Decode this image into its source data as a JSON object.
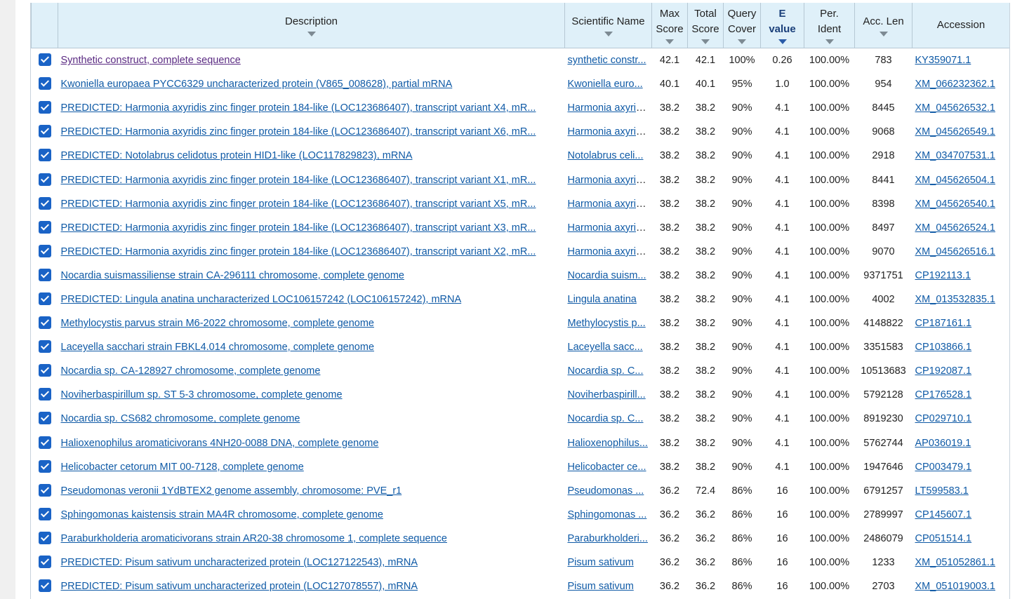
{
  "headers": {
    "description": "Description",
    "scientific_name": "Scientific Name",
    "max_score": [
      "Max",
      "Score"
    ],
    "total_score": [
      "Total",
      "Score"
    ],
    "query_cover": [
      "Query",
      "Cover"
    ],
    "e_value": [
      "E",
      "value"
    ],
    "per_ident": [
      "Per.",
      "Ident"
    ],
    "acc_len": "Acc. Len",
    "accession": "Accession"
  },
  "rows": [
    {
      "description": "Synthetic construct, complete sequence",
      "sci": "synthetic constr...",
      "max": "42.1",
      "total": "42.1",
      "cover": "100%",
      "evalue": "0.26",
      "ident": "100.00%",
      "len": "783",
      "acc": "KY359071.1"
    },
    {
      "description": "Kwoniella europaea PYCC6329 uncharacterized protein (V865_008628), partial mRNA",
      "sci": "Kwoniella euro...",
      "max": "40.1",
      "total": "40.1",
      "cover": "95%",
      "evalue": "1.0",
      "ident": "100.00%",
      "len": "954",
      "acc": "XM_066232362.1"
    },
    {
      "description": "PREDICTED: Harmonia axyridis zinc finger protein 184-like (LOC123686407), transcript variant X4, mR...",
      "sci": "Harmonia axyridis",
      "max": "38.2",
      "total": "38.2",
      "cover": "90%",
      "evalue": "4.1",
      "ident": "100.00%",
      "len": "8445",
      "acc": "XM_045626532.1"
    },
    {
      "description": "PREDICTED: Harmonia axyridis zinc finger protein 184-like (LOC123686407), transcript variant X6, mR...",
      "sci": "Harmonia axyridis",
      "max": "38.2",
      "total": "38.2",
      "cover": "90%",
      "evalue": "4.1",
      "ident": "100.00%",
      "len": "9068",
      "acc": "XM_045626549.1"
    },
    {
      "description": "PREDICTED: Notolabrus celidotus protein HID1-like (LOC117829823), mRNA",
      "sci": "Notolabrus celi...",
      "max": "38.2",
      "total": "38.2",
      "cover": "90%",
      "evalue": "4.1",
      "ident": "100.00%",
      "len": "2918",
      "acc": "XM_034707531.1"
    },
    {
      "description": "PREDICTED: Harmonia axyridis zinc finger protein 184-like (LOC123686407), transcript variant X1, mR...",
      "sci": "Harmonia axyridis",
      "max": "38.2",
      "total": "38.2",
      "cover": "90%",
      "evalue": "4.1",
      "ident": "100.00%",
      "len": "8441",
      "acc": "XM_045626504.1"
    },
    {
      "description": "PREDICTED: Harmonia axyridis zinc finger protein 184-like (LOC123686407), transcript variant X5, mR...",
      "sci": "Harmonia axyridis",
      "max": "38.2",
      "total": "38.2",
      "cover": "90%",
      "evalue": "4.1",
      "ident": "100.00%",
      "len": "8398",
      "acc": "XM_045626540.1"
    },
    {
      "description": "PREDICTED: Harmonia axyridis zinc finger protein 184-like (LOC123686407), transcript variant X3, mR...",
      "sci": "Harmonia axyridis",
      "max": "38.2",
      "total": "38.2",
      "cover": "90%",
      "evalue": "4.1",
      "ident": "100.00%",
      "len": "8497",
      "acc": "XM_045626524.1"
    },
    {
      "description": "PREDICTED: Harmonia axyridis zinc finger protein 184-like (LOC123686407), transcript variant X2, mR...",
      "sci": "Harmonia axyridis",
      "max": "38.2",
      "total": "38.2",
      "cover": "90%",
      "evalue": "4.1",
      "ident": "100.00%",
      "len": "9070",
      "acc": "XM_045626516.1"
    },
    {
      "description": "Nocardia suismassiliense strain CA-296111 chromosome, complete genome",
      "sci": "Nocardia suism...",
      "max": "38.2",
      "total": "38.2",
      "cover": "90%",
      "evalue": "4.1",
      "ident": "100.00%",
      "len": "9371751",
      "acc": "CP192113.1"
    },
    {
      "description": "PREDICTED: Lingula anatina uncharacterized LOC106157242 (LOC106157242), mRNA",
      "sci": "Lingula anatina",
      "max": "38.2",
      "total": "38.2",
      "cover": "90%",
      "evalue": "4.1",
      "ident": "100.00%",
      "len": "4002",
      "acc": "XM_013532835.1"
    },
    {
      "description": "Methylocystis parvus strain M6-2022 chromosome, complete genome",
      "sci": "Methylocystis p...",
      "max": "38.2",
      "total": "38.2",
      "cover": "90%",
      "evalue": "4.1",
      "ident": "100.00%",
      "len": "4148822",
      "acc": "CP187161.1"
    },
    {
      "description": "Laceyella sacchari strain FBKL4.014 chromosome, complete genome",
      "sci": "Laceyella sacc...",
      "max": "38.2",
      "total": "38.2",
      "cover": "90%",
      "evalue": "4.1",
      "ident": "100.00%",
      "len": "3351583",
      "acc": "CP103866.1"
    },
    {
      "description": "Nocardia sp. CA-128927 chromosome, complete genome",
      "sci": "Nocardia sp. C...",
      "max": "38.2",
      "total": "38.2",
      "cover": "90%",
      "evalue": "4.1",
      "ident": "100.00%",
      "len": "10513683",
      "acc": "CP192087.1"
    },
    {
      "description": "Noviherbaspirillum sp. ST 5-3 chromosome, complete genome",
      "sci": "Noviherbaspirill...",
      "max": "38.2",
      "total": "38.2",
      "cover": "90%",
      "evalue": "4.1",
      "ident": "100.00%",
      "len": "5792128",
      "acc": "CP176528.1"
    },
    {
      "description": "Nocardia sp. CS682 chromosome, complete genome",
      "sci": "Nocardia sp. C...",
      "max": "38.2",
      "total": "38.2",
      "cover": "90%",
      "evalue": "4.1",
      "ident": "100.00%",
      "len": "8919230",
      "acc": "CP029710.1"
    },
    {
      "description": "Halioxenophilus aromaticivorans 4NH20-0088 DNA, complete genome",
      "sci": "Halioxenophilus...",
      "max": "38.2",
      "total": "38.2",
      "cover": "90%",
      "evalue": "4.1",
      "ident": "100.00%",
      "len": "5762744",
      "acc": "AP036019.1"
    },
    {
      "description": "Helicobacter cetorum MIT 00-7128, complete genome",
      "sci": "Helicobacter ce...",
      "max": "38.2",
      "total": "38.2",
      "cover": "90%",
      "evalue": "4.1",
      "ident": "100.00%",
      "len": "1947646",
      "acc": "CP003479.1"
    },
    {
      "description": "Pseudomonas veronii 1YdBTEX2 genome assembly, chromosome: PVE_r1",
      "sci": "Pseudomonas ...",
      "max": "36.2",
      "total": "72.4",
      "cover": "86%",
      "evalue": "16",
      "ident": "100.00%",
      "len": "6791257",
      "acc": "LT599583.1"
    },
    {
      "description": "Sphingomonas kaistensis strain MA4R chromosome, complete genome",
      "sci": "Sphingomonas ...",
      "max": "36.2",
      "total": "36.2",
      "cover": "86%",
      "evalue": "16",
      "ident": "100.00%",
      "len": "2789997",
      "acc": "CP145607.1"
    },
    {
      "description": "Paraburkholderia aromaticivorans strain AR20-38 chromosome 1, complete sequence",
      "sci": "Paraburkholderi...",
      "max": "36.2",
      "total": "36.2",
      "cover": "86%",
      "evalue": "16",
      "ident": "100.00%",
      "len": "2486079",
      "acc": "CP051514.1"
    },
    {
      "description": "PREDICTED: Pisum sativum uncharacterized protein (LOC127122543), mRNA",
      "sci": "Pisum sativum",
      "max": "36.2",
      "total": "36.2",
      "cover": "86%",
      "evalue": "16",
      "ident": "100.00%",
      "len": "1233",
      "acc": "XM_051052861.1"
    },
    {
      "description": "PREDICTED: Pisum sativum uncharacterized protein (LOC127078557), mRNA",
      "sci": "Pisum sativum",
      "max": "36.2",
      "total": "36.2",
      "cover": "86%",
      "evalue": "16",
      "ident": "100.00%",
      "len": "2703",
      "acc": "XM_051019003.1"
    }
  ]
}
